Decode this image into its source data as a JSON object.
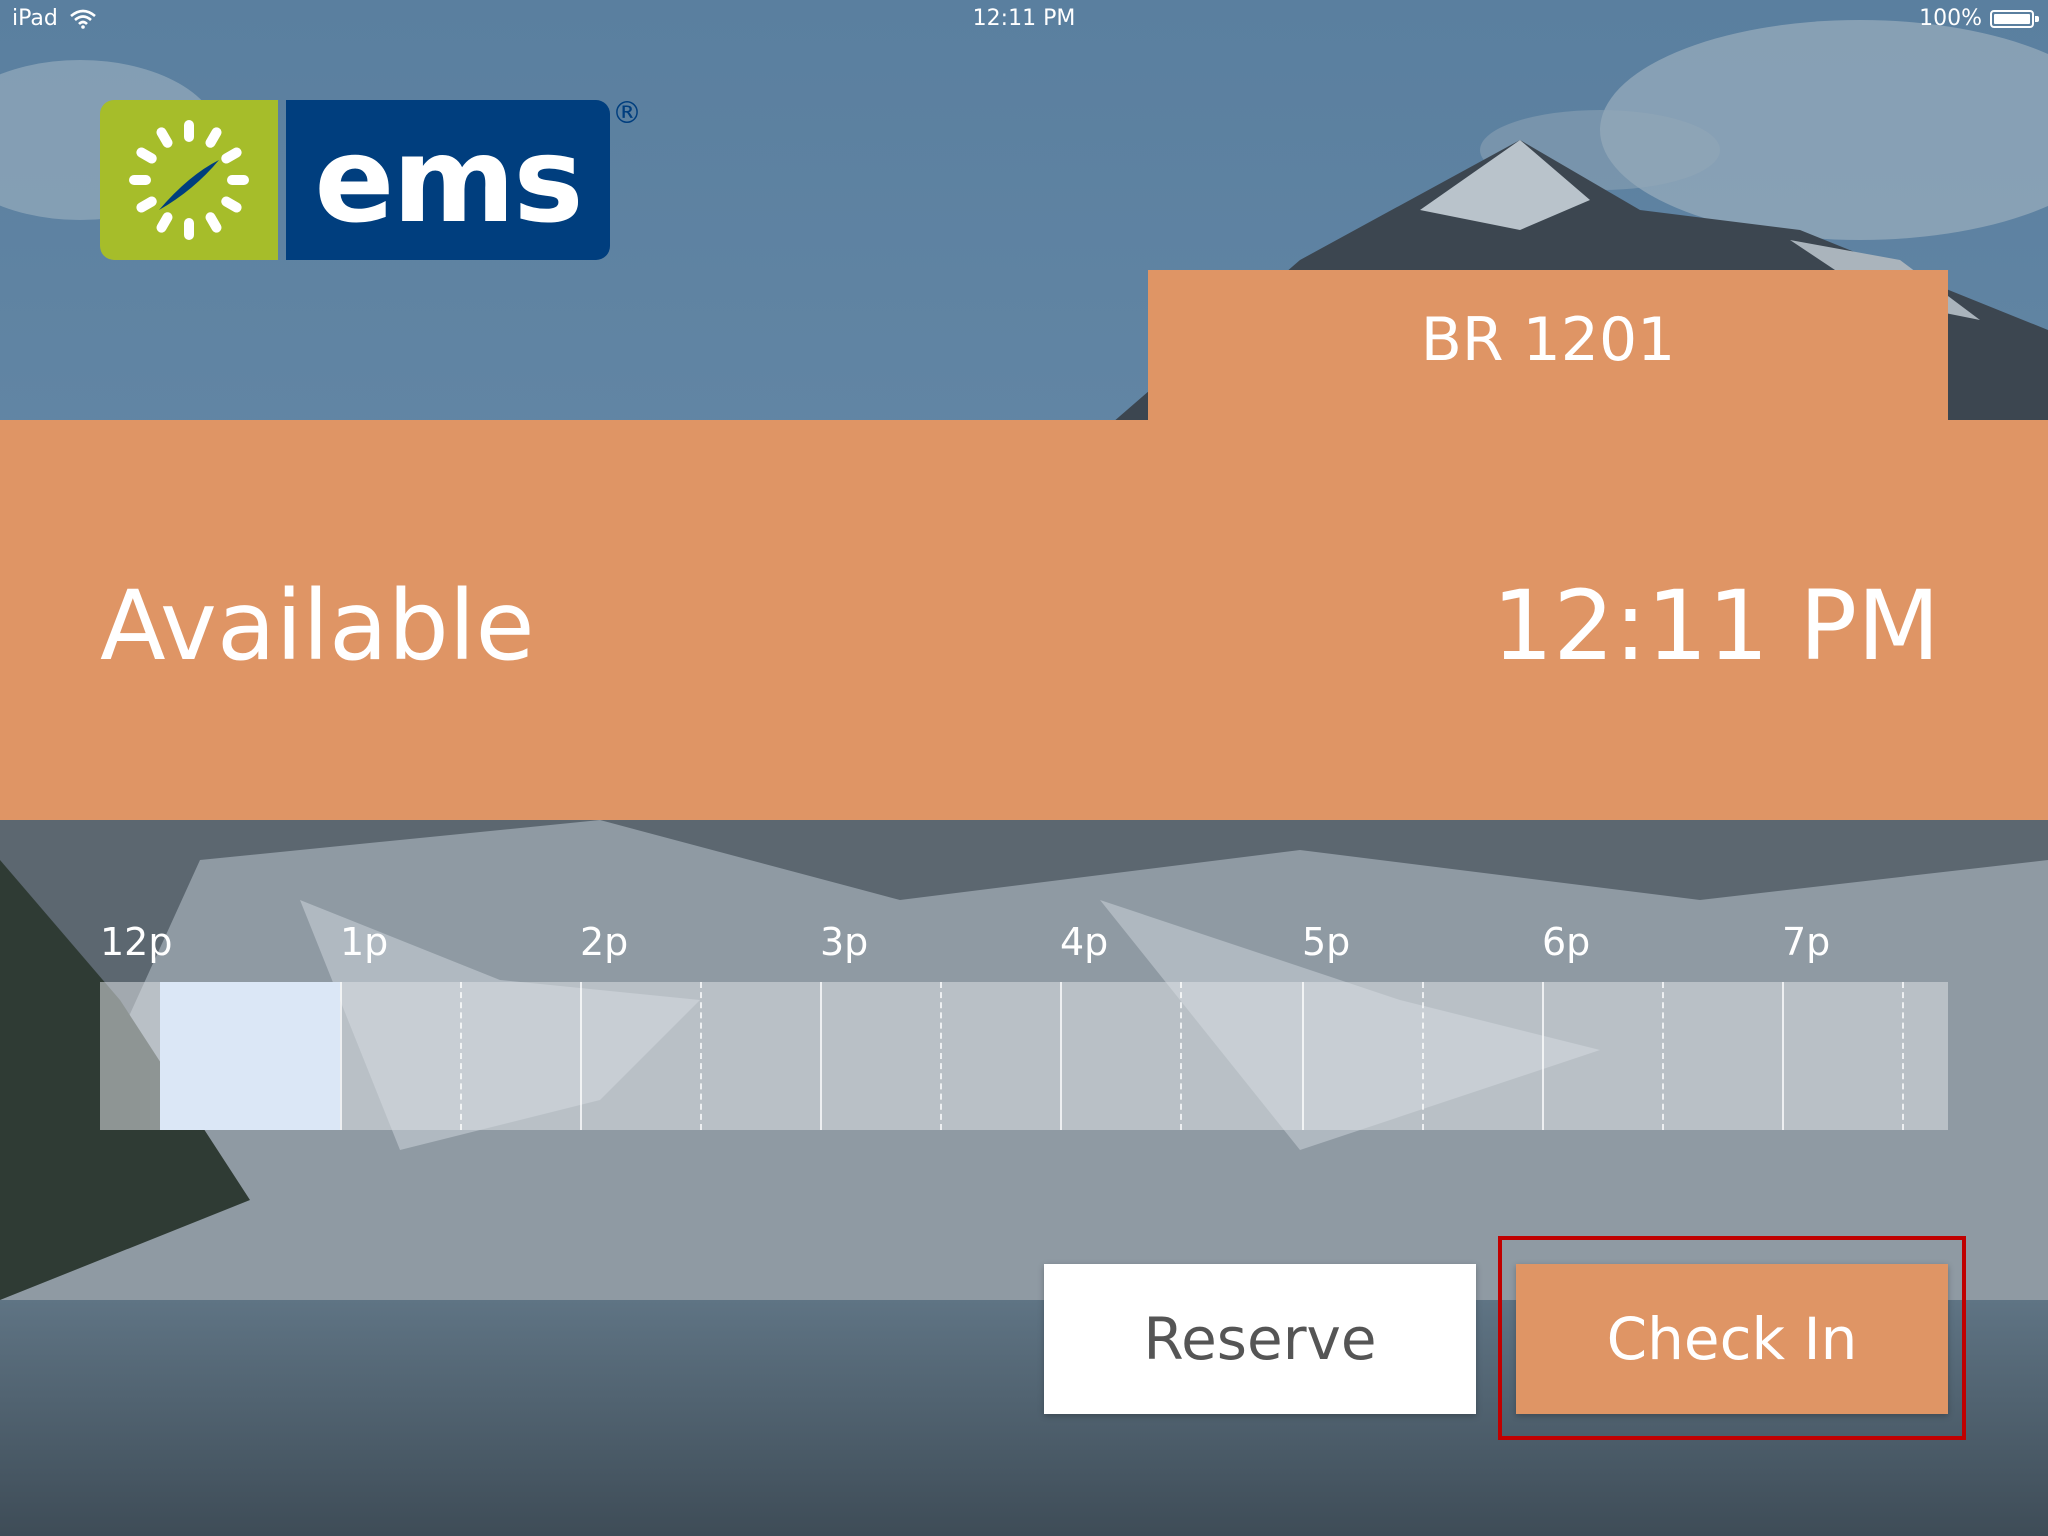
{
  "status_bar": {
    "device": "iPad",
    "time": "12:11 PM",
    "battery": "100%"
  },
  "logo": {
    "text": "ems",
    "registered": "®"
  },
  "room": {
    "name": "BR 1201"
  },
  "band": {
    "status": "Available",
    "clock": "12:11 PM"
  },
  "timeline": {
    "hours": [
      "12p",
      "1p",
      "2p",
      "3p",
      "4p",
      "5p",
      "6p",
      "7p"
    ]
  },
  "actions": {
    "reserve_label": "Reserve",
    "checkin_label": "Check In"
  },
  "colors": {
    "accent": "#df9565",
    "logo_green": "#a6bd2a",
    "logo_blue": "#003e7e",
    "highlight": "#c00000"
  }
}
